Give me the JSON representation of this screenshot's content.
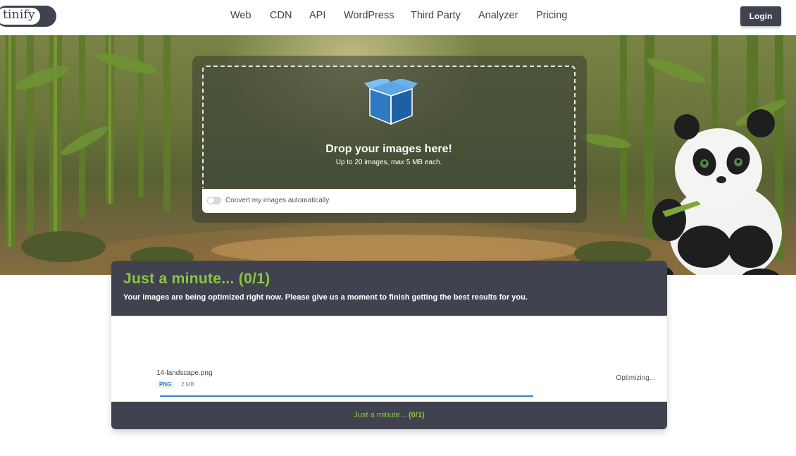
{
  "header": {
    "logo": "tinify",
    "nav": [
      "Web",
      "CDN",
      "API",
      "WordPress",
      "Third Party",
      "Analyzer",
      "Pricing"
    ],
    "login": "Login"
  },
  "dropzone": {
    "title": "Drop your images here!",
    "subtitle": "Up to 20 images, max 5 MB each.",
    "convert_label": "Convert my images automatically",
    "convert_enabled": false,
    "icon": "box-icon"
  },
  "results": {
    "title": "Just a minute... (0/1)",
    "description": "Your images are being optimized right now. Please give us a moment to finish getting the best results for you.",
    "files": [
      {
        "name": "14-landscape.png",
        "type": "PNG",
        "size": "2 MB",
        "status": "Optimizing...",
        "progress": 1.0
      }
    ],
    "footer_text": "Just a minute...",
    "footer_count": "(0/1)"
  },
  "colors": {
    "dark": "#40434f",
    "accent_green": "#8dc63f",
    "accent_blue": "#3a85c4"
  }
}
